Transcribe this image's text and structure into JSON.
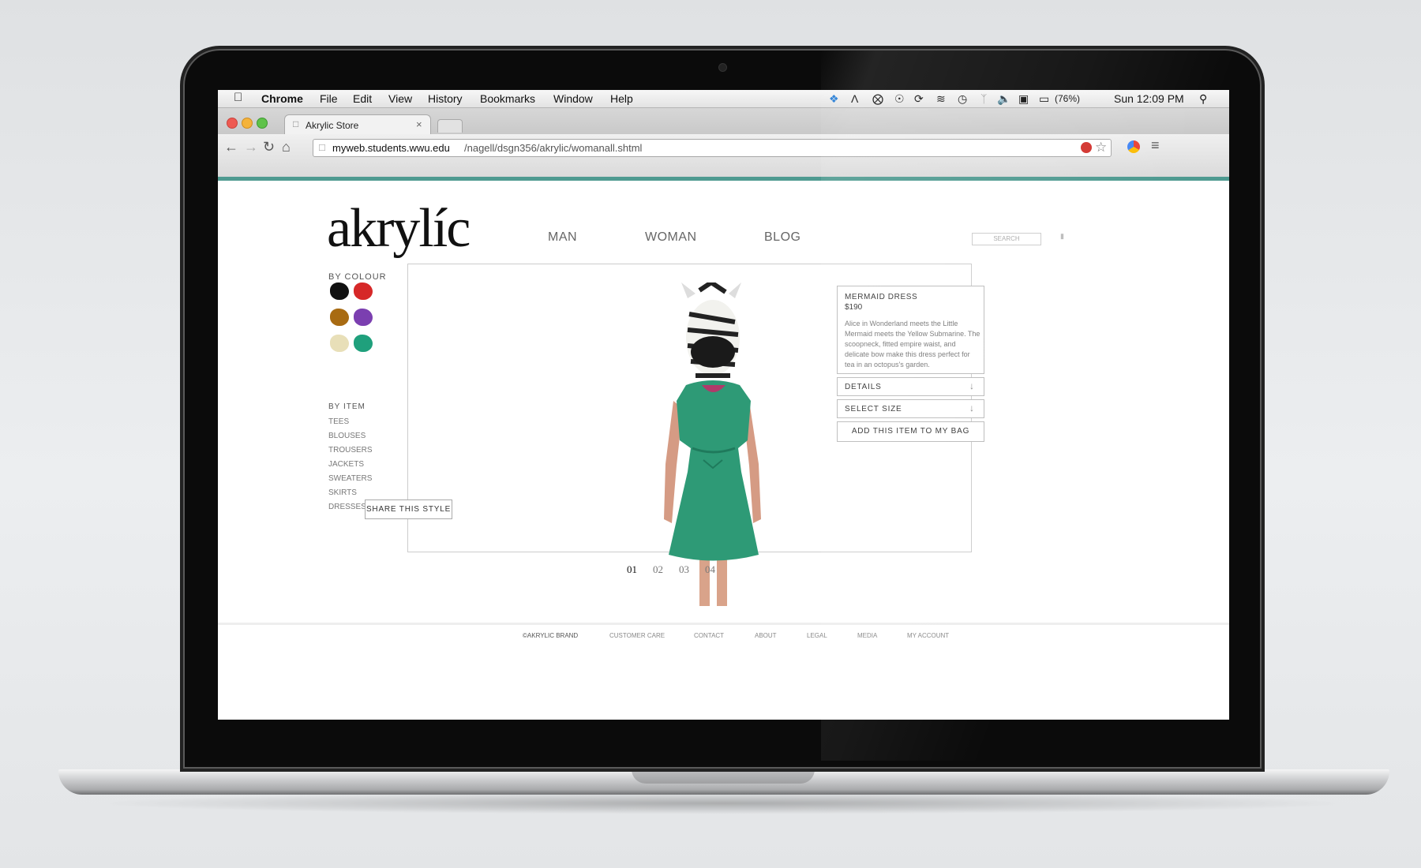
{
  "mac_menu": {
    "app": "Chrome",
    "items": [
      "File",
      "Edit",
      "View",
      "History",
      "Bookmarks",
      "Window",
      "Help"
    ],
    "battery": "(76%)",
    "clock": "Sun 12:09 PM"
  },
  "browser": {
    "tab_title": "Akrylic Store",
    "url_host": "myweb.students.wwu.edu",
    "url_path": "/nagell/dsgn356/akrylic/womanall.shtml"
  },
  "site": {
    "logo": "akrylíc",
    "nav": [
      "MAN",
      "WOMAN",
      "BLOG"
    ],
    "search_placeholder": "SEARCH",
    "by_colour_heading": "BY COLOUR",
    "colours": [
      "#111111",
      "#d62828",
      "#a86b12",
      "#7b3fb0",
      "#e8dfb8",
      "#1fa07c"
    ],
    "by_item_heading": "BY ITEM",
    "items": [
      "TEES",
      "BLOUSES",
      "TROUSERS",
      "JACKETS",
      "SWEATERS",
      "SKIRTS",
      "DRESSES"
    ],
    "share_label": "SHARE THIS STYLE"
  },
  "product": {
    "name": "MERMAID DRESS",
    "price": "$190",
    "description": "Alice in Wonderland meets the Little Mermaid meets the Yellow Submarine. The scoopneck, fitted empire waist, and delicate bow make this dress perfect for tea in an octopus's garden.",
    "details_label": "DETAILS",
    "size_label": "SELECT SIZE",
    "add_label": "ADD THIS ITEM TO MY BAG"
  },
  "pagination": [
    "01",
    "02",
    "03",
    "04"
  ],
  "footer": [
    "©AKRYLIC BRAND",
    "CUSTOMER CARE",
    "CONTACT",
    "ABOUT",
    "LEGAL",
    "MEDIA",
    "MY ACCOUNT"
  ]
}
